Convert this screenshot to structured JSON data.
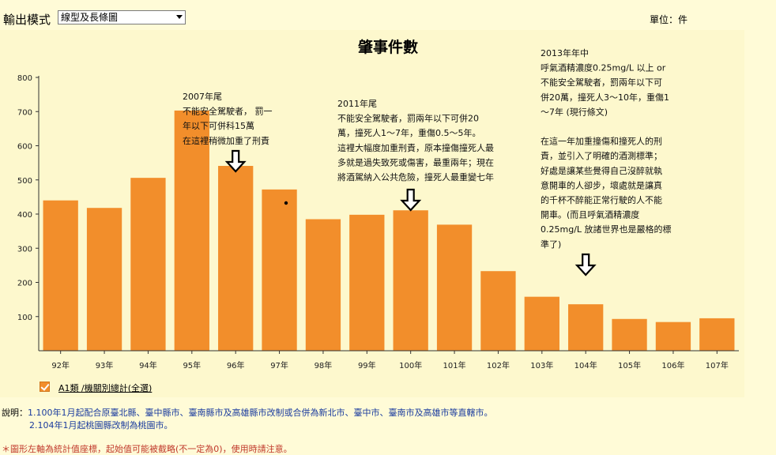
{
  "toolbar": {
    "mode_label": "輸出模式",
    "mode_value": "線型及長條圖",
    "unit_label": "單位：件"
  },
  "colors": {
    "bar": "#f28e2b",
    "background": "#fffbd7",
    "plot": "#fdf8cd",
    "footer_text": "#1b3c9e",
    "warning_text": "#c0392b"
  },
  "chart_data": {
    "type": "bar",
    "title": "肇事件數",
    "xlabel": "",
    "ylabel": "",
    "categories": [
      "92年",
      "93年",
      "94年",
      "95年",
      "96年",
      "97年",
      "98年",
      "99年",
      "100年",
      "101年",
      "102年",
      "103年",
      "104年",
      "105年",
      "106年",
      "107年"
    ],
    "series": [
      {
        "name": "A1類 /機關別總計(全選)",
        "values": [
          440,
          418,
          506,
          703,
          541,
          472,
          385,
          398,
          411,
          369,
          233,
          158,
          136,
          93,
          84,
          95
        ]
      }
    ],
    "yticks": [
      100,
      200,
      300,
      400,
      500,
      600,
      700,
      800
    ],
    "ylim": [
      0,
      800
    ],
    "grid": false,
    "legend": "bottom-left",
    "annotations": [
      {
        "lines": [
          "2007年尾",
          "不能安全駕駛者， 罰一",
          "年以下可併科15萬",
          "在這裡稍微加重了刑責"
        ],
        "arrow_category": "96年"
      },
      {
        "lines": [
          "2011年尾",
          "不能安全駕駛者，罰兩年以下可併20",
          "萬，撞死人1～7年，重傷0.5～5年。",
          "這裡大幅度加重刑責，原本撞傷撞死人最",
          "多就是過失致死或傷害，最重兩年；現在",
          "將酒駕納入公共危險，撞死人最重變七年"
        ],
        "arrow_category": "100年"
      },
      {
        "lines": [
          "2013年年中",
          "呼氣酒精濃度0.25mg/L 以上 or",
          "不能安全駕駛者，罰兩年以下可",
          "併20萬，撞死人3～10年，重傷1",
          "～7年 (現行條文)",
          "",
          "在這一年加重撞傷和撞死人的刑",
          "責，並引入了明確的酒測標準；",
          "好處是讓某些覺得自己沒醉就執",
          "意開車的人卻步，壞處就是讓真",
          "的千杯不醉能正常行駛的人不能",
          "開車。(而且呼氣酒精濃度",
          "0.25mg/L 放諸世界也是嚴格的標",
          "準了)"
        ],
        "arrow_category": "104年"
      }
    ]
  },
  "footer": {
    "note_prefix": "說明：",
    "note1": "1.100年1月起配合原臺北縣、臺中縣市、臺南縣市及高雄縣市改制或合併為新北市、臺中市、臺南市及高雄市等直轄市。",
    "note2": "2.104年1月起桃園縣改制為桃園市。",
    "warning": "＊圖形左軸為統計值座標，起始值可能被截略(不一定為0)，使用時請注意。"
  }
}
